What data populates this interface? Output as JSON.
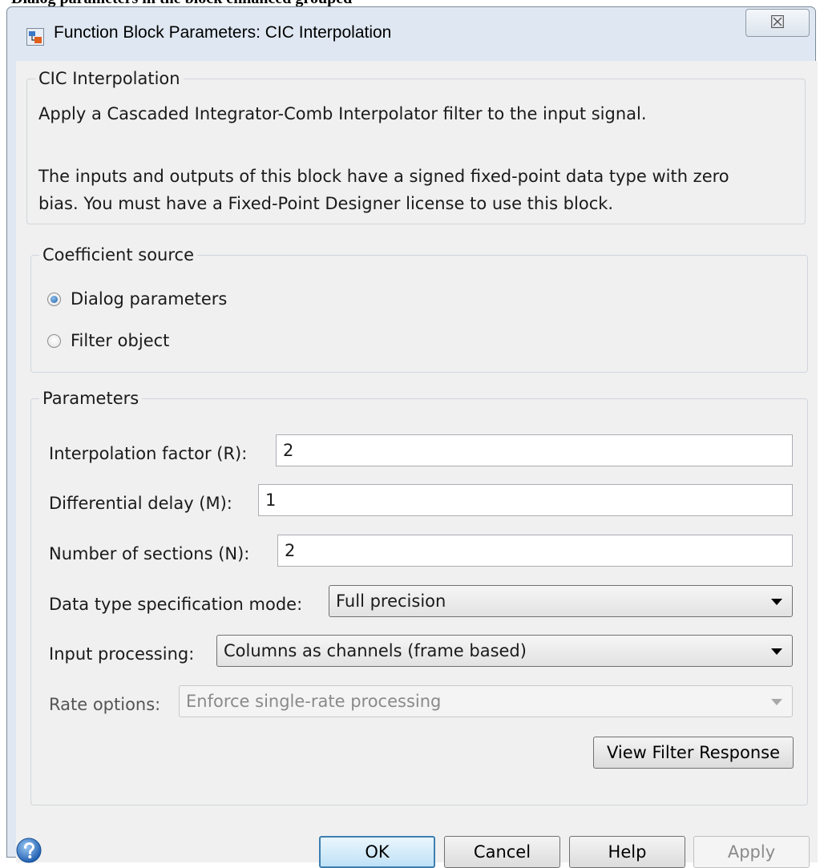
{
  "top_caption": "Dialog parameters in the block enhanced grouped",
  "window": {
    "title": "Function Block Parameters: CIC Interpolation",
    "close_glyph": "☒"
  },
  "block_group": {
    "legend": "CIC Interpolation",
    "description_1": "Apply a Cascaded Integrator-Comb Interpolator filter to the input signal.",
    "description_2_line1": "The inputs and outputs of this block have a signed fixed-point data type with zero",
    "description_2_line2": "bias. You must have a Fixed-Point Designer license to use this block."
  },
  "coefficient_source": {
    "legend": "Coefficient source",
    "options": [
      {
        "label": "Dialog parameters",
        "checked": true
      },
      {
        "label": "Filter object",
        "checked": false
      }
    ]
  },
  "parameters": {
    "legend": "Parameters",
    "interpolation_factor": {
      "label": "Interpolation factor (R):",
      "value": "2"
    },
    "differential_delay": {
      "label": "Differential delay (M):",
      "value": "1"
    },
    "number_of_sections": {
      "label": "Number of sections (N):",
      "value": "2"
    },
    "data_type_mode": {
      "label": "Data type specification mode:",
      "value": "Full precision"
    },
    "input_processing": {
      "label": "Input processing:",
      "value": "Columns as channels (frame based)"
    },
    "rate_options": {
      "label": "Rate options:",
      "value": "Enforce single-rate processing"
    },
    "view_filter_response": "View Filter Response"
  },
  "footer": {
    "ok": "OK",
    "cancel": "Cancel",
    "help": "Help",
    "apply": "Apply"
  },
  "colors": {
    "window_frame": "#dfe8f2",
    "client": "#f0f0f0",
    "default_button_border": "#3c7fb1",
    "help_icon": "#2a6cc0"
  }
}
